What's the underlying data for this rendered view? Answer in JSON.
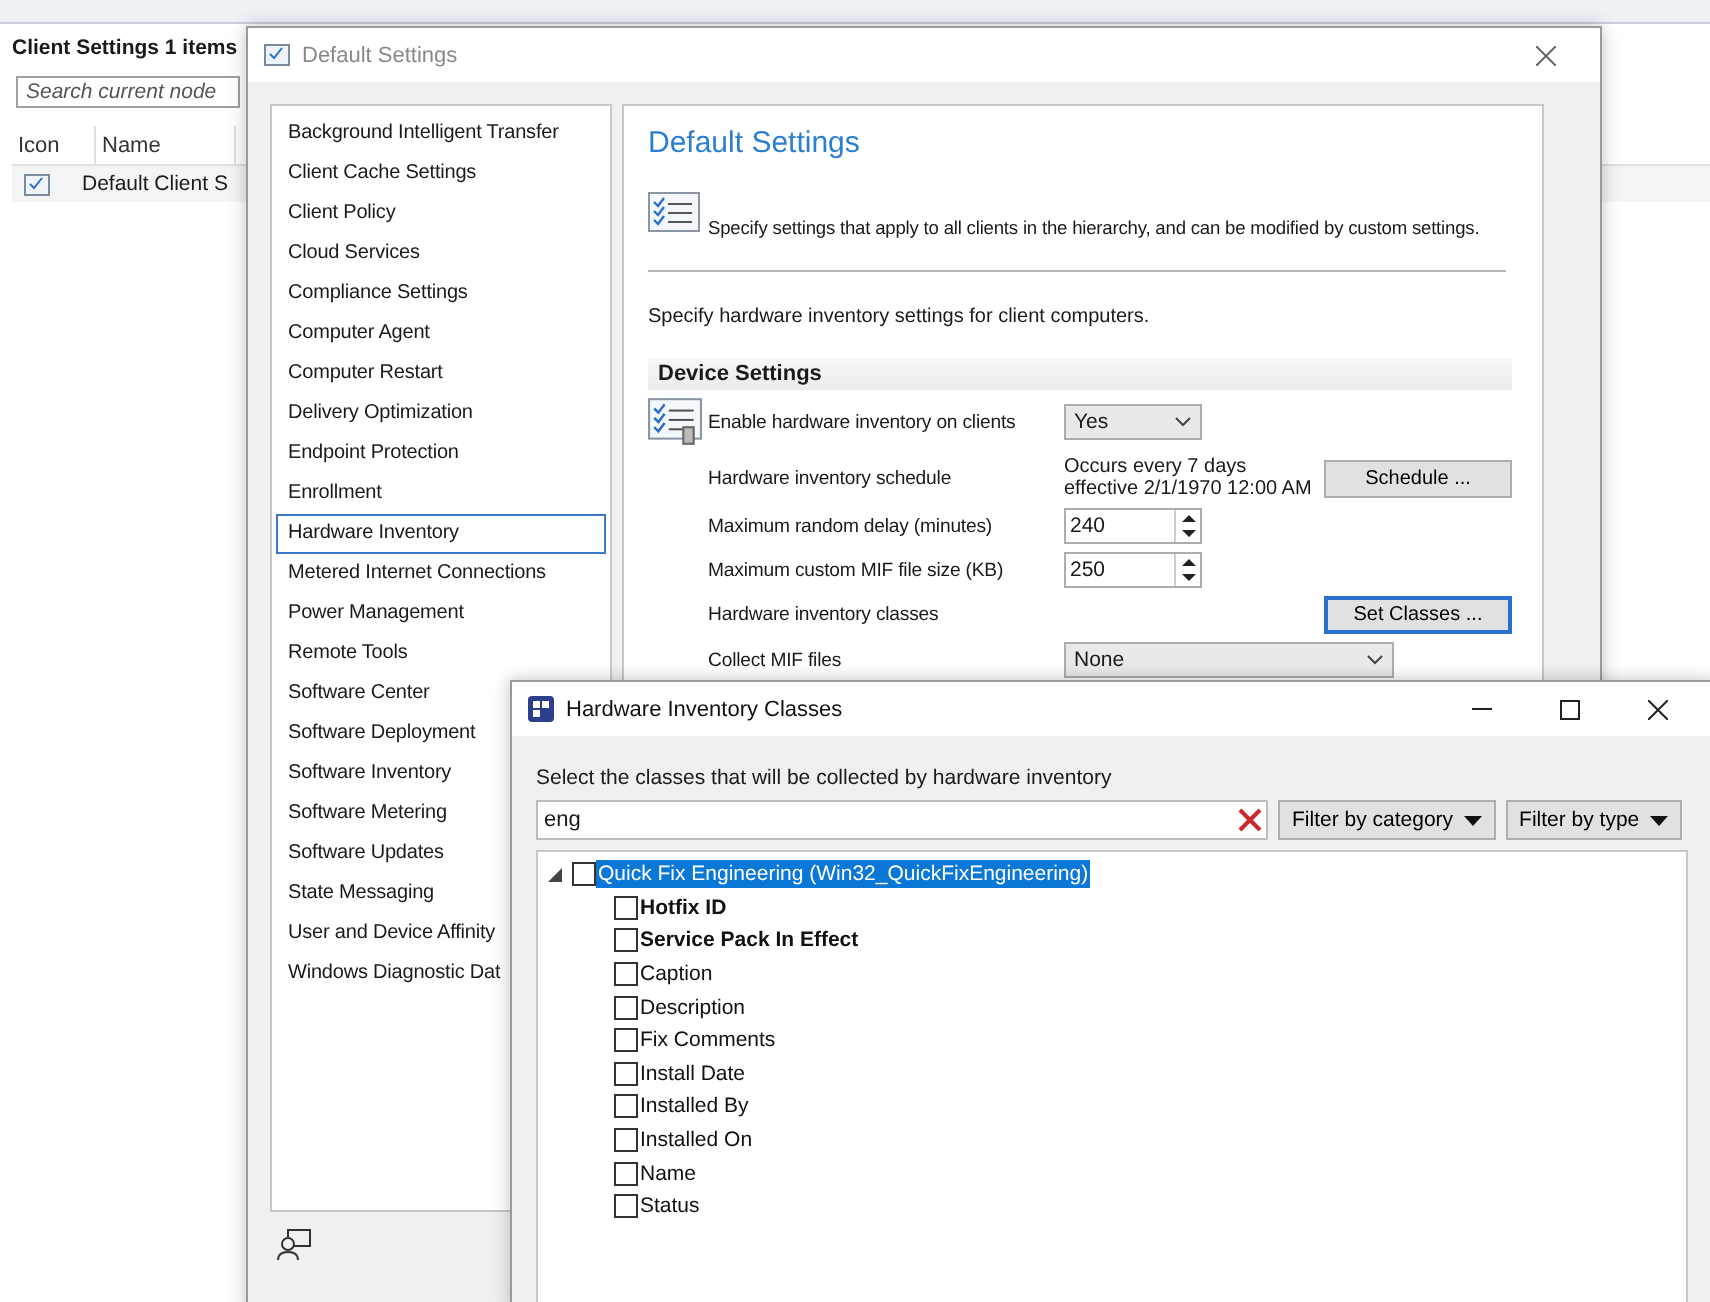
{
  "console": {
    "title": "Client Settings 1 items",
    "search": {
      "placeholder": "Search current node"
    },
    "columns": [
      "Icon",
      "Name"
    ],
    "rows": [
      {
        "name": "Default Client S"
      }
    ]
  },
  "settings_window": {
    "title": "Default Settings",
    "nav": [
      {
        "label": "Background Intelligent Transfer",
        "selected": false
      },
      {
        "label": "Client Cache Settings",
        "selected": false
      },
      {
        "label": "Client Policy",
        "selected": false
      },
      {
        "label": "Cloud Services",
        "selected": false
      },
      {
        "label": "Compliance Settings",
        "selected": false
      },
      {
        "label": "Computer Agent",
        "selected": false
      },
      {
        "label": "Computer Restart",
        "selected": false
      },
      {
        "label": "Delivery Optimization",
        "selected": false
      },
      {
        "label": "Endpoint Protection",
        "selected": false
      },
      {
        "label": "Enrollment",
        "selected": false
      },
      {
        "label": "Hardware Inventory",
        "selected": true
      },
      {
        "label": "Metered Internet Connections",
        "selected": false
      },
      {
        "label": "Power Management",
        "selected": false
      },
      {
        "label": "Remote Tools",
        "selected": false
      },
      {
        "label": "Software Center",
        "selected": false
      },
      {
        "label": "Software Deployment",
        "selected": false
      },
      {
        "label": "Software Inventory",
        "selected": false
      },
      {
        "label": "Software Metering",
        "selected": false
      },
      {
        "label": "Software Updates",
        "selected": false
      },
      {
        "label": "State Messaging",
        "selected": false
      },
      {
        "label": "User and Device Affinity",
        "selected": false
      },
      {
        "label": "Windows Diagnostic Dat",
        "selected": false
      }
    ],
    "heading": "Default Settings",
    "description": "Specify settings that apply to all clients in the hierarchy, and can be modified by custom settings.",
    "intro": "Specify hardware inventory settings for client computers.",
    "section": "Device Settings",
    "rows": [
      {
        "kind": "select",
        "icon": true,
        "label": "Enable hardware inventory on clients",
        "value": "Yes"
      },
      {
        "kind": "text",
        "label": "Hardware inventory schedule",
        "value": "Occurs every 7 days effective 2/1/1970 12:00 AM",
        "button": {
          "label": "Schedule ...",
          "focused": false
        }
      },
      {
        "kind": "spin",
        "label": "Maximum random delay (minutes)",
        "value": "240"
      },
      {
        "kind": "spin",
        "label": "Maximum custom MIF file size (KB)",
        "value": "250"
      },
      {
        "kind": "none",
        "label": "Hardware inventory classes",
        "button": {
          "label": "Set Classes ...",
          "focused": true
        }
      },
      {
        "kind": "wideselect",
        "label": "Collect MIF files",
        "value": "None"
      }
    ]
  },
  "classes_window": {
    "title": "Hardware Inventory Classes",
    "prompt": "Select the classes that will be collected by hardware inventory",
    "search": {
      "value": "eng"
    },
    "filters": [
      "Filter by category",
      "Filter by type"
    ],
    "tree": [
      {
        "label": "Quick Fix Engineering (Win32_QuickFixEngineering)",
        "checked": false,
        "selected": true,
        "expanded": true,
        "children": [
          {
            "label": "Hotfix ID",
            "checked": false,
            "key": true,
            "selected": false
          },
          {
            "label": "Service Pack In Effect",
            "checked": false,
            "key": true,
            "selected": false
          },
          {
            "label": "Caption",
            "checked": false,
            "key": false,
            "selected": false
          },
          {
            "label": "Description",
            "checked": false,
            "key": false,
            "selected": false
          },
          {
            "label": "Fix Comments",
            "checked": false,
            "key": false,
            "selected": false
          },
          {
            "label": "Install Date",
            "checked": false,
            "key": false,
            "selected": false
          },
          {
            "label": "Installed By",
            "checked": false,
            "key": false,
            "selected": false
          },
          {
            "label": "Installed On",
            "checked": false,
            "key": false,
            "selected": false
          },
          {
            "label": "Name",
            "checked": false,
            "key": false,
            "selected": false
          },
          {
            "label": "Status",
            "checked": false,
            "key": false,
            "selected": false
          }
        ]
      }
    ]
  }
}
